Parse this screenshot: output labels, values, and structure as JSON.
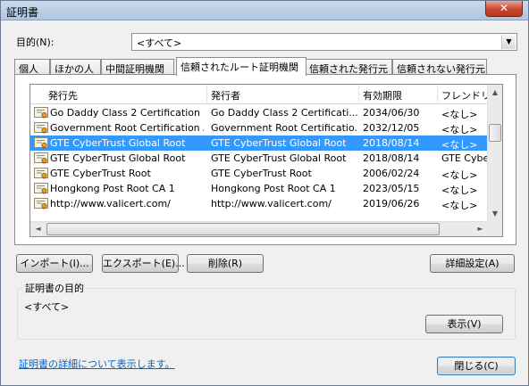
{
  "window": {
    "title": "証明書",
    "close_label": "✕"
  },
  "purpose": {
    "label": "目的(N):",
    "selected": "<すべて>"
  },
  "tabs": [
    {
      "label": "個人"
    },
    {
      "label": "ほかの人"
    },
    {
      "label": "中間証明機関"
    },
    {
      "label": "信頼されたルート証明機関"
    },
    {
      "label": "信頼された発行元"
    },
    {
      "label": "信頼されない発行元"
    }
  ],
  "columns": [
    {
      "label": "発行先"
    },
    {
      "label": "発行者"
    },
    {
      "label": "有効期限"
    },
    {
      "label": "フレンドリ名"
    }
  ],
  "rows": [
    {
      "issued_to": "Go Daddy Class 2 Certification ...",
      "issued_by": "Go Daddy Class 2 Certificati...",
      "expires": "2034/06/30",
      "friendly": "<なし>"
    },
    {
      "issued_to": "Government Root Certification A...",
      "issued_by": "Government Root Certificatio...",
      "expires": "2032/12/05",
      "friendly": "<なし>"
    },
    {
      "issued_to": "GTE CyberTrust Global Root",
      "issued_by": "GTE CyberTrust Global Root",
      "expires": "2018/08/14",
      "friendly": "<なし>",
      "selected": true
    },
    {
      "issued_to": "GTE CyberTrust Global Root",
      "issued_by": "GTE CyberTrust Global Root",
      "expires": "2018/08/14",
      "friendly": "GTE Cybe"
    },
    {
      "issued_to": "GTE CyberTrust Root",
      "issued_by": "GTE CyberTrust Root",
      "expires": "2006/02/24",
      "friendly": "<なし>"
    },
    {
      "issued_to": "Hongkong Post Root CA 1",
      "issued_by": "Hongkong Post Root CA 1",
      "expires": "2023/05/15",
      "friendly": "<なし>"
    },
    {
      "issued_to": "http://www.valicert.com/",
      "issued_by": "http://www.valicert.com/",
      "expires": "2019/06/26",
      "friendly": "<なし>"
    }
  ],
  "buttons": {
    "import": "インポート(I)...",
    "export": "エクスポート(E)...",
    "remove": "削除(R)",
    "advanced": "詳細設定(A)",
    "view": "表示(V)",
    "close": "閉じる(C)"
  },
  "purposes_group": {
    "label": "証明書の目的",
    "value": "<すべて>"
  },
  "details_link": "証明書の詳細について表示します。",
  "icons": {
    "cert": "certificate-icon",
    "scroll_up": "▲",
    "scroll_down": "▼",
    "scroll_left": "◄",
    "scroll_right": "►",
    "dropdown": "▼"
  },
  "colors": {
    "selection": "#3399ff",
    "link": "#0066cc",
    "close_button": "#c9482f"
  }
}
